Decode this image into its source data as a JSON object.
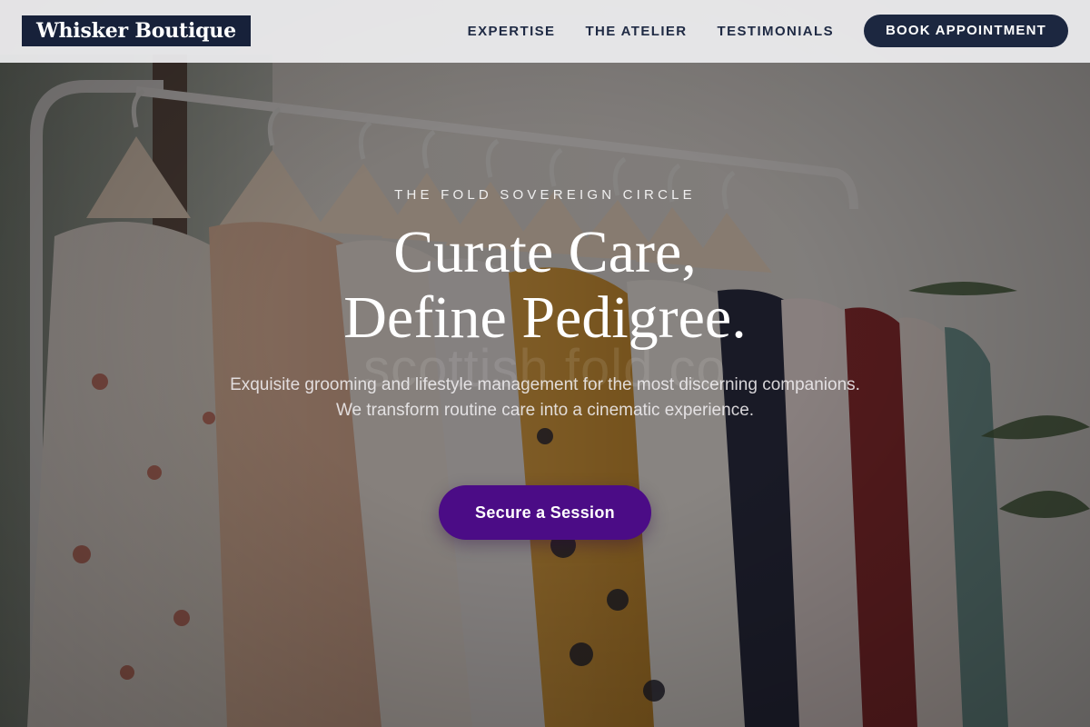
{
  "header": {
    "logo": "Whisker Boutique",
    "nav": [
      {
        "label": "EXPERTISE"
      },
      {
        "label": "THE ATELIER"
      },
      {
        "label": "TESTIMONIALS"
      }
    ],
    "cta_label": "BOOK APPOINTMENT"
  },
  "hero": {
    "eyebrow": "THE FOLD SOVEREIGN CIRCLE",
    "headline_line1": "Curate Care,",
    "headline_line2": "Define Pedigree.",
    "watermark": "scottish fold co",
    "subtext": "Exquisite grooming and lifestyle management for the most discerning companions. We transform routine care into a cinematic experience.",
    "cta_label": "Secure a Session",
    "background_image": "clothing-rack-photo"
  },
  "colors": {
    "header_bg": "#ececee",
    "logo_bg": "#17213a",
    "nav_text": "#1f2a44",
    "nav_cta_bg": "#1c2740",
    "hero_cta_bg": "#4b0c86",
    "hero_text": "#ffffff"
  }
}
